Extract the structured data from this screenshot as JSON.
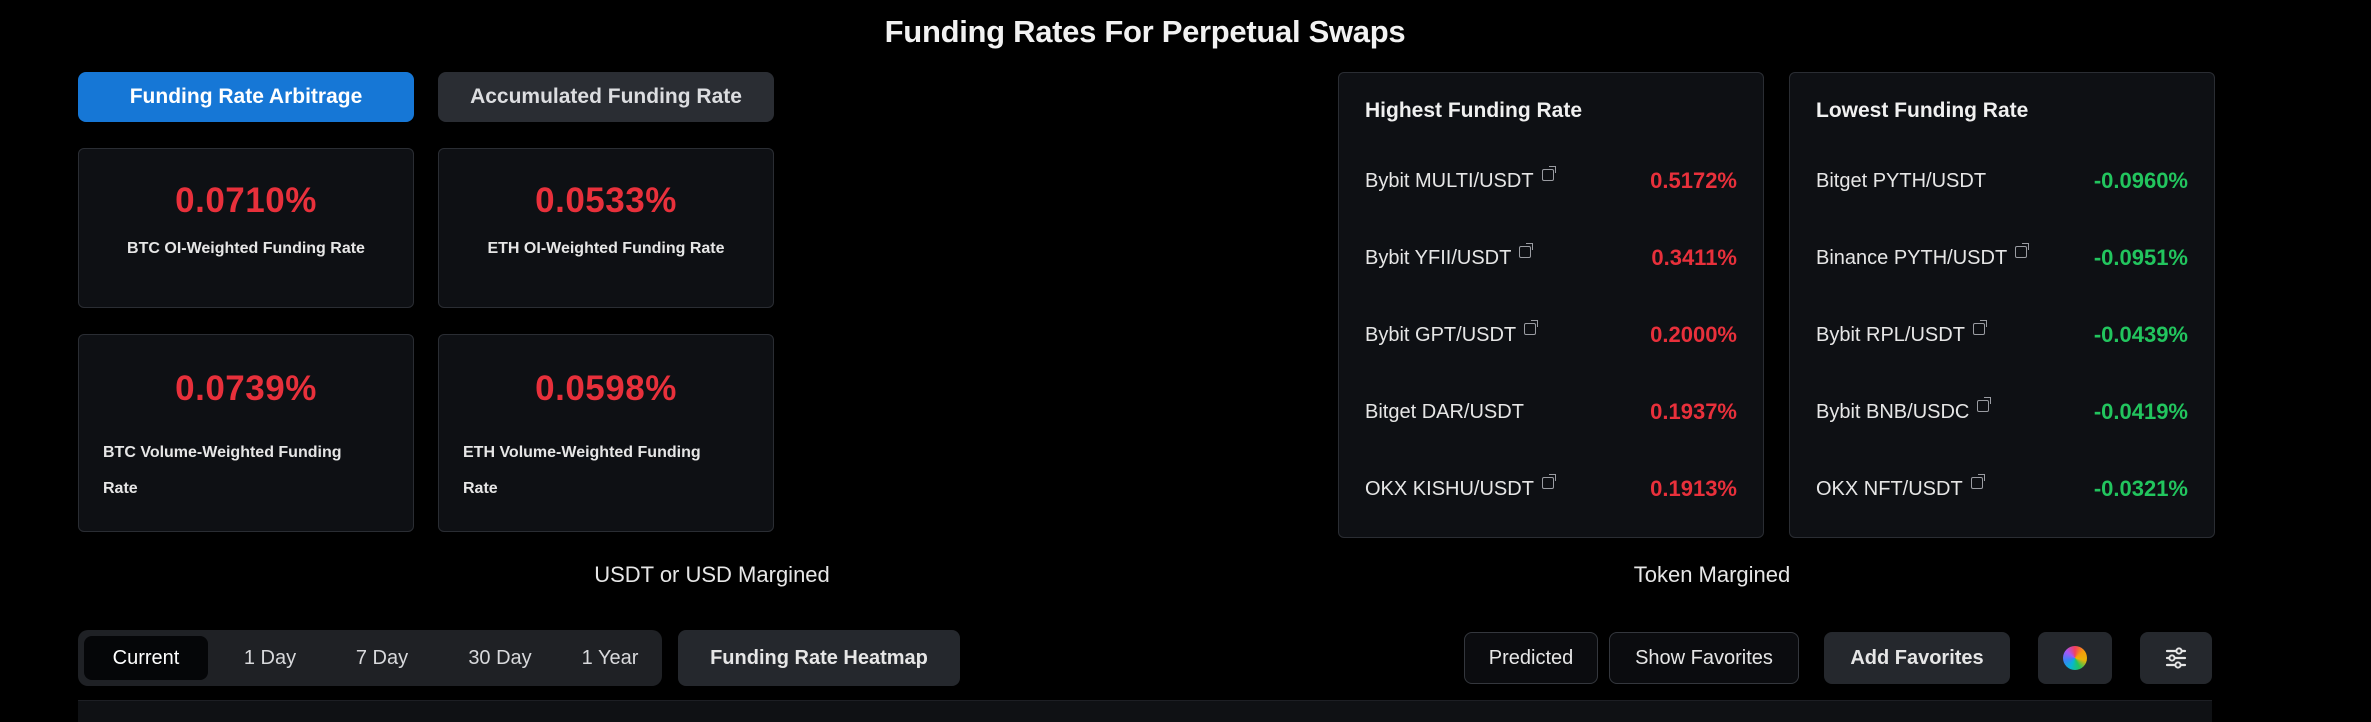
{
  "page_title": "Funding Rates For Perpetual Swaps",
  "top_tabs": {
    "arbitrage": "Funding Rate Arbitrage",
    "accumulated": "Accumulated Funding Rate"
  },
  "weighted": {
    "btc_oi": {
      "value": "0.0710%",
      "label": "BTC OI-Weighted Funding Rate"
    },
    "eth_oi": {
      "value": "0.0533%",
      "label": "ETH OI-Weighted Funding Rate"
    },
    "btc_vol": {
      "value": "0.0739%",
      "label_line1": "BTC Volume-Weighted Funding",
      "label_line2": "Rate"
    },
    "eth_vol": {
      "value": "0.0598%",
      "label_line1": "ETH Volume-Weighted Funding",
      "label_line2": "Rate"
    }
  },
  "highest": {
    "title": "Highest Funding Rate",
    "rows": [
      {
        "pair": "Bybit MULTI/USDT",
        "rate": "0.5172%"
      },
      {
        "pair": "Bybit YFII/USDT",
        "rate": "0.3411%"
      },
      {
        "pair": "Bybit GPT/USDT",
        "rate": "0.2000%"
      },
      {
        "pair": "Bitget DAR/USDT",
        "rate": "0.1937%"
      },
      {
        "pair": "OKX KISHU/USDT",
        "rate": "0.1913%"
      }
    ]
  },
  "lowest": {
    "title": "Lowest Funding Rate",
    "rows": [
      {
        "pair": "Bitget PYTH/USDT",
        "rate": "-0.0960%"
      },
      {
        "pair": "Binance PYTH/USDT",
        "rate": "-0.0951%"
      },
      {
        "pair": "Bybit RPL/USDT",
        "rate": "-0.0439%"
      },
      {
        "pair": "Bybit BNB/USDC",
        "rate": "-0.0419%"
      },
      {
        "pair": "OKX NFT/USDT",
        "rate": "-0.0321%"
      }
    ]
  },
  "sections": {
    "usdt": "USDT or USD Margined",
    "token": "Token Margined"
  },
  "time_tabs": [
    "Current",
    "1 Day",
    "7 Day",
    "30 Day",
    "1 Year"
  ],
  "active_time_tab": "Current",
  "heatmap_button": "Funding Rate Heatmap",
  "right_buttons": {
    "predicted": "Predicted",
    "show_favorites": "Show Favorites",
    "add_favorites": "Add Favorites"
  },
  "icons": {
    "color": "color-wheel-icon",
    "settings": "sliders-icon",
    "external": "external-link-icon"
  },
  "colors": {
    "accent": "#1677d6",
    "positive_rate": "#e8303b",
    "negative_rate": "#22c55e"
  }
}
